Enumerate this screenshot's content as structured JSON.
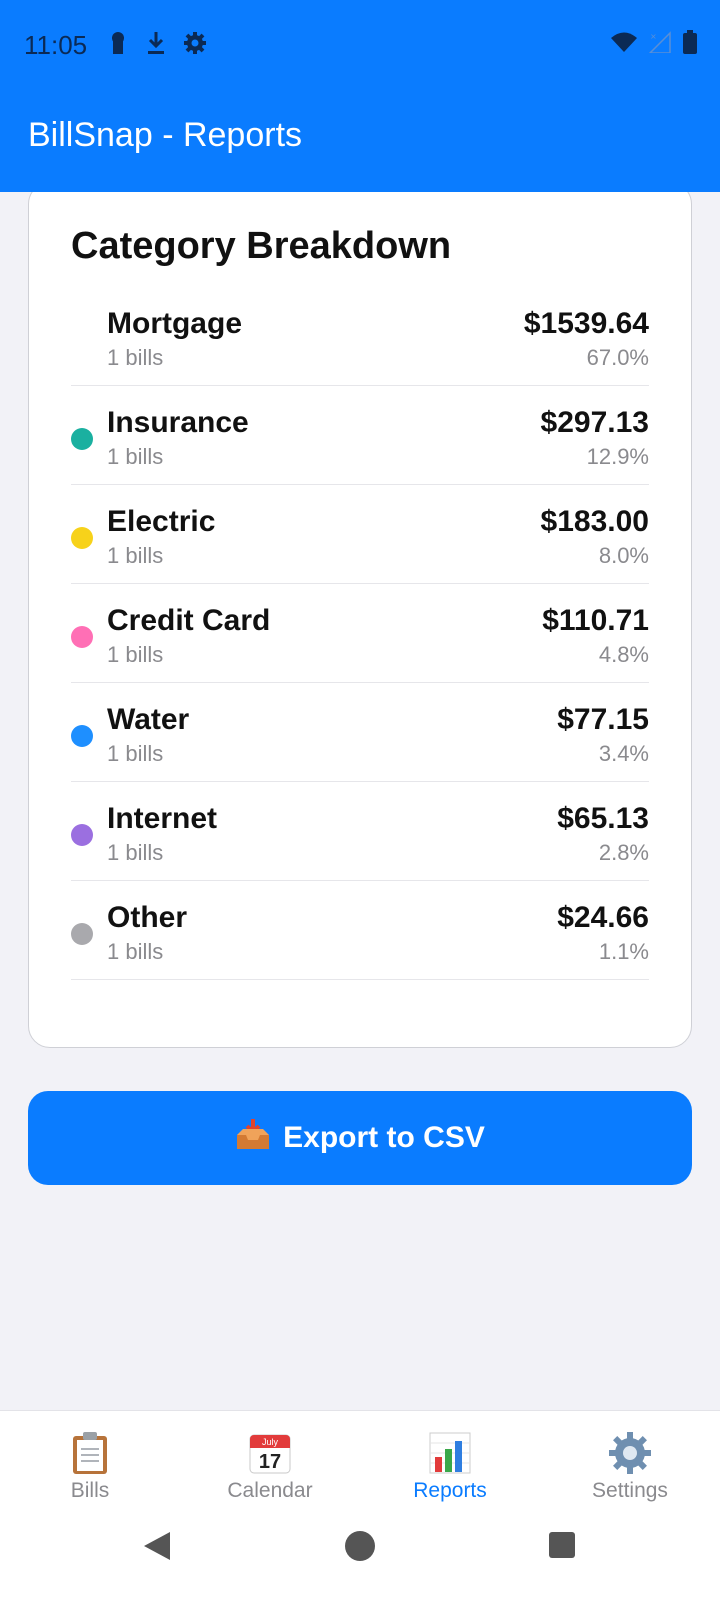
{
  "status_bar": {
    "time": "11:05",
    "icons": [
      "keyhole-icon",
      "download-icon",
      "gear-icon",
      "wifi-icon",
      "signal-icon",
      "battery-icon"
    ]
  },
  "app_bar": {
    "title": "BillSnap - Reports"
  },
  "card": {
    "title": "Category Breakdown",
    "categories": [
      {
        "name": "Mortgage",
        "count": "1 bills",
        "amount": "$1539.64",
        "percent": "67.0%",
        "color": ""
      },
      {
        "name": "Insurance",
        "count": "1 bills",
        "amount": "$297.13",
        "percent": "12.9%",
        "color": "#1ab0a0"
      },
      {
        "name": "Electric",
        "count": "1 bills",
        "amount": "$183.00",
        "percent": "8.0%",
        "color": "#f7d21a"
      },
      {
        "name": "Credit Card",
        "count": "1 bills",
        "amount": "$110.71",
        "percent": "4.8%",
        "color": "#ff6fb5"
      },
      {
        "name": "Water",
        "count": "1 bills",
        "amount": "$77.15",
        "percent": "3.4%",
        "color": "#1e8fff"
      },
      {
        "name": "Internet",
        "count": "1 bills",
        "amount": "$65.13",
        "percent": "2.8%",
        "color": "#9b6fe0"
      },
      {
        "name": "Other",
        "count": "1 bills",
        "amount": "$24.66",
        "percent": "1.1%",
        "color": "#a9a9ad"
      }
    ]
  },
  "export": {
    "label": "Export to CSV",
    "icon": "inbox-tray-icon"
  },
  "bottom_nav": {
    "tabs": [
      {
        "label": "Bills",
        "icon": "clipboard-icon",
        "active": false
      },
      {
        "label": "Calendar",
        "icon": "calendar-icon",
        "active": false,
        "calendar_month": "July",
        "calendar_day": "17"
      },
      {
        "label": "Reports",
        "icon": "bar-chart-icon",
        "active": true
      },
      {
        "label": "Settings",
        "icon": "gear-icon",
        "active": false
      }
    ]
  },
  "colors": {
    "primary": "#0a7cff",
    "background": "#f2f2f7"
  }
}
